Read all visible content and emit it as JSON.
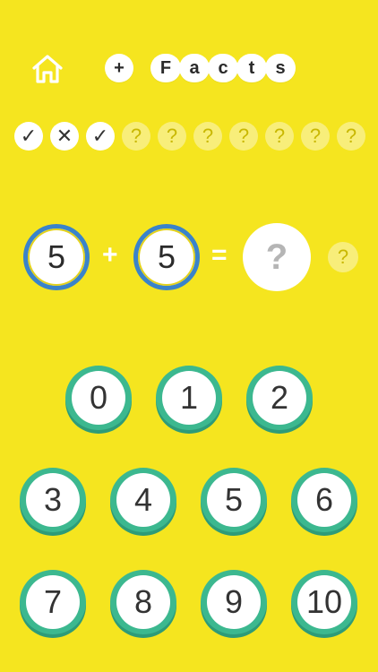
{
  "header": {
    "home_icon": "home-icon",
    "operation": "+",
    "title_letters": [
      "F",
      "a",
      "c",
      "t",
      "s"
    ]
  },
  "progress": [
    {
      "status": "correct",
      "glyph": "✓"
    },
    {
      "status": "wrong",
      "glyph": "✕"
    },
    {
      "status": "correct",
      "glyph": "✓"
    },
    {
      "status": "pending",
      "glyph": "?"
    },
    {
      "status": "pending",
      "glyph": "?"
    },
    {
      "status": "pending",
      "glyph": "?"
    },
    {
      "status": "pending",
      "glyph": "?"
    },
    {
      "status": "pending",
      "glyph": "?"
    },
    {
      "status": "pending",
      "glyph": "?"
    },
    {
      "status": "pending",
      "glyph": "?"
    }
  ],
  "equation": {
    "operand_a": "5",
    "operator": "+",
    "operand_b": "5",
    "equals": "=",
    "answer": "?",
    "hint": "?"
  },
  "keypad": [
    "0",
    "1",
    "2",
    "3",
    "4",
    "5",
    "6",
    "7",
    "8",
    "9",
    "10"
  ],
  "colors": {
    "background": "#f5e51f",
    "ring_blue": "#3a83c9",
    "key_green": "#3cb88f"
  }
}
